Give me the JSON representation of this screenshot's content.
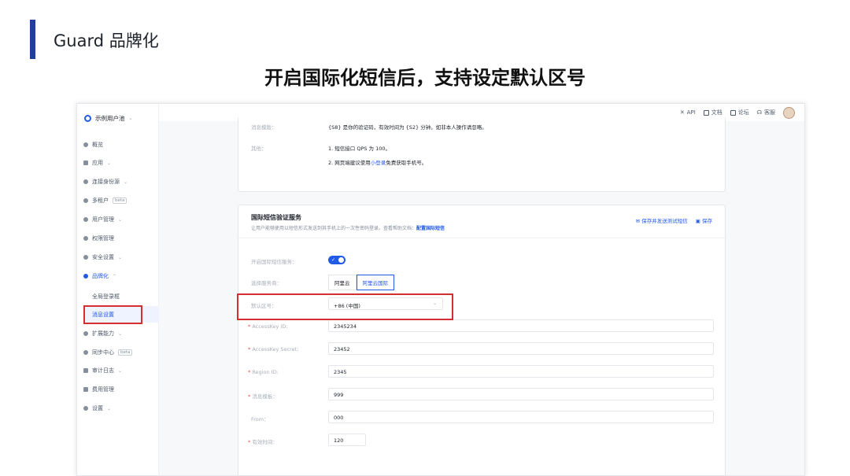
{
  "slide": {
    "title": "Guard 品牌化",
    "subtitle": "开启国际化短信后，支持设定默认区号"
  },
  "app": {
    "pool_name": "示例用户池",
    "sidebar": {
      "items": [
        {
          "label": "概览"
        },
        {
          "label": "应用"
        },
        {
          "label": "连接身份源"
        },
        {
          "label": "多租户",
          "badge": "beta"
        },
        {
          "label": "用户管理"
        },
        {
          "label": "权限管理"
        },
        {
          "label": "安全设置"
        },
        {
          "label": "品牌化"
        },
        {
          "label": "扩展能力"
        },
        {
          "label": "同步中心",
          "badge": "beta"
        },
        {
          "label": "审计日志"
        },
        {
          "label": "费用管理"
        },
        {
          "label": "设置"
        }
      ],
      "sub_items": [
        {
          "label": "全局登录框"
        },
        {
          "label": "消息设置"
        }
      ]
    },
    "topbar": {
      "api": "API",
      "docs": "文档",
      "forum": "论坛",
      "support": "客服"
    },
    "top_card": {
      "template_label": "消息模版：",
      "template_value": "{S8} 是你的验证码，有效时间为 {S2} 分钟。如非本人操作请忽略。",
      "other_label": "其他：",
      "other_line1": "1. 短信接口 QPS 为 100。",
      "other_line2_prefix": "2. 网页端建议使用",
      "other_line2_link": "小登录",
      "other_line2_suffix": "免费获取手机号。"
    },
    "intl_sms": {
      "title": "国际短信验证服务",
      "desc_prefix": "让用户能够使用以短信形式发送到其手机上的一次性密码登录。查看帮助文档：",
      "desc_link": "配置国际短信",
      "save_and_test": "保存并发送测试短信",
      "save": "保存",
      "enable_label": "开启国际短信服务：",
      "enabled": true,
      "provider_label": "选择服务商：",
      "providers": [
        "阿里云",
        "阿里云国际"
      ],
      "selected_provider": "阿里云国际",
      "area_code_label": "默认区号：",
      "area_code_value": "+86 (中国)",
      "fields": [
        {
          "label": "AccessKey ID:",
          "value": "2345234",
          "required": true
        },
        {
          "label": "AccessKey Secret:",
          "value": "23452",
          "required": true
        },
        {
          "label": "Region ID:",
          "value": "2345",
          "required": true
        },
        {
          "label": "消息模板：",
          "value": "999",
          "required": true
        },
        {
          "label": "From：",
          "value": "000",
          "required": false
        },
        {
          "label": "有效时间：",
          "value": "120",
          "required": true
        }
      ]
    }
  }
}
